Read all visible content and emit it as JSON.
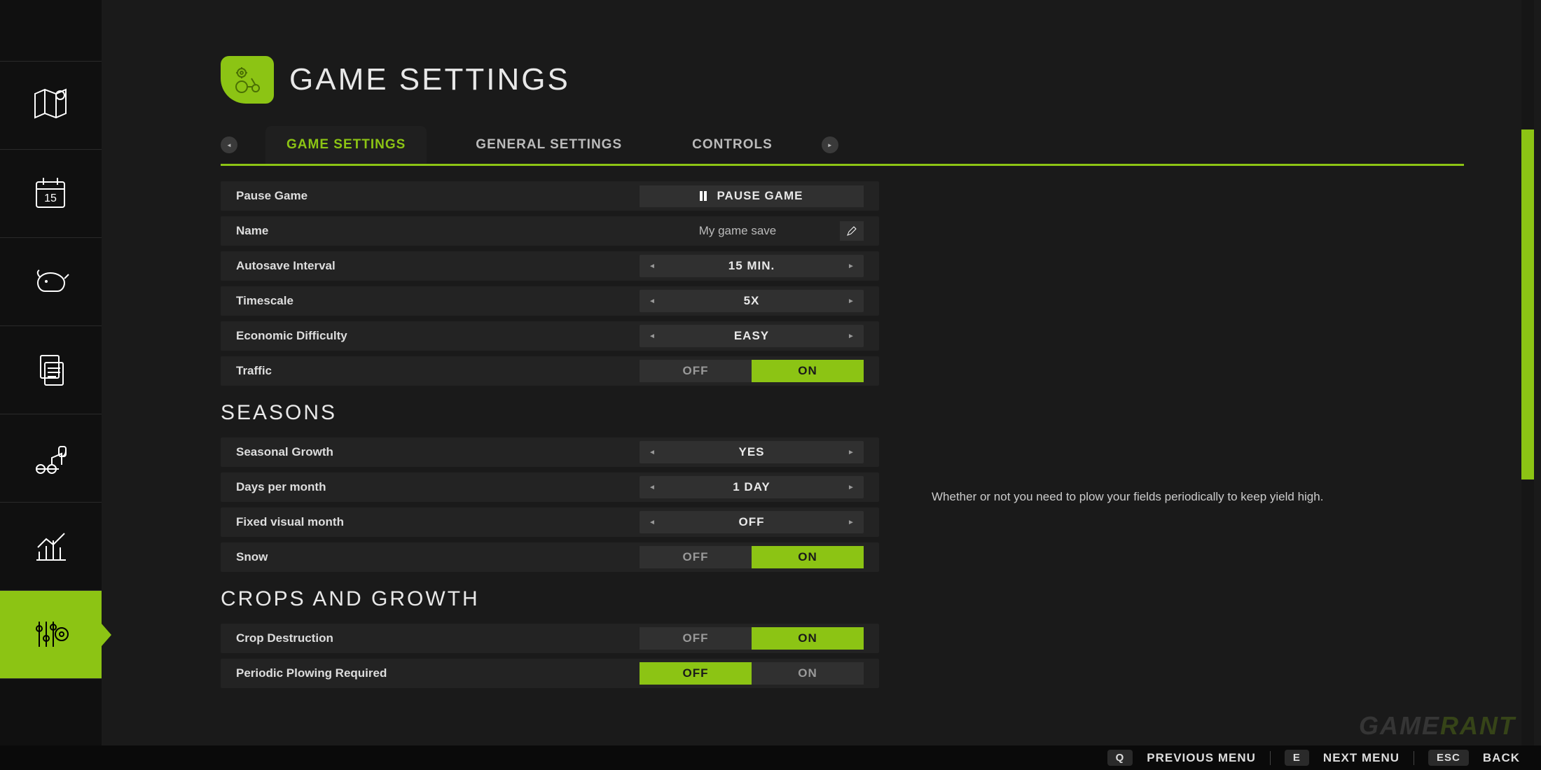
{
  "header": {
    "title": "GAME SETTINGS"
  },
  "tabs": {
    "prev": "◄",
    "next": "►",
    "items": [
      "GAME SETTINGS",
      "GENERAL SETTINGS",
      "CONTROLS"
    ],
    "active": 0
  },
  "rows": {
    "pause": {
      "label": "Pause Game",
      "button": "PAUSE GAME"
    },
    "name": {
      "label": "Name",
      "value": "My game save"
    },
    "autosave": {
      "label": "Autosave Interval",
      "value": "15 MIN."
    },
    "timescale": {
      "label": "Timescale",
      "value": "5X"
    },
    "economy": {
      "label": "Economic Difficulty",
      "value": "EASY"
    },
    "traffic": {
      "label": "Traffic",
      "off": "OFF",
      "on": "ON",
      "value": "ON"
    },
    "seasonal": {
      "label": "Seasonal Growth",
      "value": "YES"
    },
    "dpm": {
      "label": "Days per month",
      "value": "1 DAY"
    },
    "fvm": {
      "label": "Fixed visual month",
      "value": "OFF"
    },
    "snow": {
      "label": "Snow",
      "off": "OFF",
      "on": "ON",
      "value": "ON"
    },
    "cropd": {
      "label": "Crop Destruction",
      "off": "OFF",
      "on": "ON",
      "value": "ON"
    },
    "plow": {
      "label": "Periodic Plowing Required",
      "off": "OFF",
      "on": "ON",
      "value": "OFF"
    }
  },
  "sections": {
    "seasons": "SEASONS",
    "crops": "CROPS AND GROWTH"
  },
  "hint": "Whether or not you need to plow your fields periodically to keep yield high.",
  "footer": {
    "q": "Q",
    "prev": "PREVIOUS MENU",
    "e": "E",
    "next": "NEXT MENU",
    "esc": "ESC",
    "back": "BACK"
  },
  "watermark": {
    "a": "GAME",
    "b": "RANT"
  },
  "glyph": {
    "left": "◄",
    "right": "►"
  }
}
